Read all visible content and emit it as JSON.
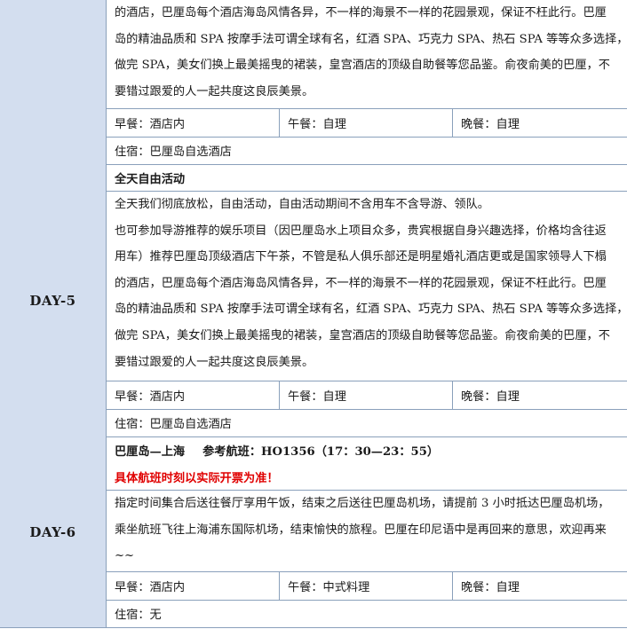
{
  "blocks": [
    {
      "day": "",
      "paragraph_lines": [
        "的酒店，巴厘岛每个酒店海岛风情各异，不一样的海景不一样的花园景观，保证不枉此行。巴厘",
        "岛的精油品质和 SPA 按摩手法可谓全球有名，红酒 SPA、巧克力 SPA、热石 SPA 等等众多选择，",
        "做完 SPA，美女们换上最美摇曳的裙装，皇宫酒店的顶级自助餐等您品鉴。俞夜俞美的巴厘，不",
        "要错过跟爱的人一起共度这良辰美景。"
      ],
      "meals": [
        "早餐：酒店内",
        "午餐：自理",
        "晚餐：自理"
      ],
      "stay": "住宿：巴厘岛自选酒店"
    },
    {
      "day": "DAY-5",
      "title": "全天自由活动",
      "paragraph_lines": [
        "全天我们彻底放松，自由活动，自由活动期间不含用车不含导游、领队。",
        "也可参加导游推荐的娱乐项目（因巴厘岛水上项目众多，贵宾根据自身兴趣选择，价格均含往返",
        "用车）推荐巴厘岛顶级酒店下午茶，不管是私人俱乐部还是明星婚礼酒店更或是国家领导人下榻",
        "的酒店，巴厘岛每个酒店海岛风情各异，不一样的海景不一样的花园景观，保证不枉此行。巴厘",
        "岛的精油品质和 SPA 按摩手法可谓全球有名，红酒 SPA、巧克力 SPA、热石 SPA 等等众多选择，",
        "做完 SPA，美女们换上最美摇曳的裙装，皇宫酒店的顶级自助餐等您品鉴。俞夜俞美的巴厘，不",
        "要错过跟爱的人一起共度这良辰美景。"
      ],
      "meals": [
        "早餐：酒店内",
        "午餐：自理",
        "晚餐：自理"
      ],
      "stay": "住宿：巴厘岛自选酒店"
    },
    {
      "day": "DAY-6",
      "route": "巴厘岛—上海",
      "flight": "参考航班：HO1356（17：30—23：55）",
      "notice": "具体航班时刻以实际开票为准！",
      "paragraph_lines": [
        "指定时间集合后送往餐厅享用午饭，结束之后送往巴厘岛机场，请提前 3 小时抵达巴厘岛机场，",
        "乘坐航班飞往上海浦东国际机场，结束愉快的旅程。巴厘在印尼语中是再回来的意思，欢迎再来",
        "~~"
      ],
      "meals": [
        "早餐：酒店内",
        "午餐：中式料理",
        "晚餐：自理"
      ],
      "stay": "住宿：无"
    }
  ]
}
